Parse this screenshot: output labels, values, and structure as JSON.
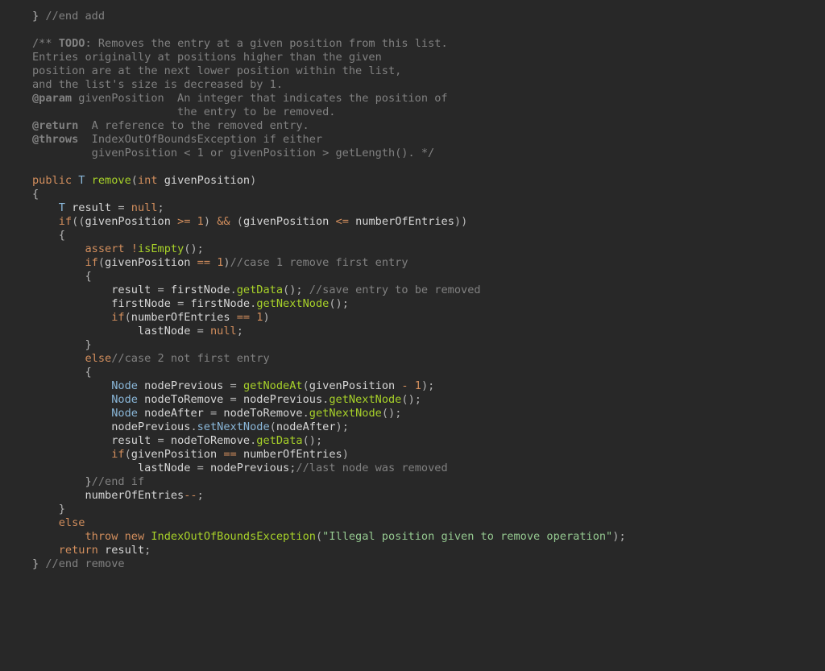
{
  "code": {
    "line01_a": "}",
    "line01_b": " //end add",
    "line03_a": "/** ",
    "line03_b": "TODO",
    "line03_c": ": Removes the entry at a given position from this list.",
    "line04": "Entries originally at positions higher than the given",
    "line05": "position are at the next lower position within the list,",
    "line06": "and the list's size is decreased by 1.",
    "line07_a": "@param",
    "line07_b": " givenPosition  An integer that indicates the position of",
    "line08": "                      the entry to be removed.",
    "line09_a": "@return",
    "line09_b": "  A reference to the removed entry.",
    "line10_a": "@throws",
    "line10_b": "  IndexOutOfBoundsException if either",
    "line11": "         givenPosition < 1 or givenPosition > getLength(). */",
    "kw_public": "public",
    "type_T": "T",
    "m_remove": "remove",
    "type_int": "int",
    "id_givenPosition": "givenPosition",
    "brace_open": "{",
    "brace_close": "}",
    "paren_open": "(",
    "paren_close": ")",
    "semi": ";",
    "space": " ",
    "indent1": "    ",
    "indent2": "        ",
    "indent3": "            ",
    "indent4": "                ",
    "id_result": "result",
    "assign": " = ",
    "kw_null": "null",
    "kw_if": "if",
    "op_ge": " >= ",
    "num_1": "1",
    "op_and": " && ",
    "op_le": " <= ",
    "id_numberOfEntries": "numberOfEntries",
    "kw_assert": "assert",
    "op_not": "!",
    "m_isEmpty": "isEmpty",
    "op_eq": " == ",
    "cmt_case1": "//case 1 remove first entry",
    "id_firstNode": "firstNode",
    "dot": ".",
    "m_getData": "getData",
    "cmt_save": " //save entry to be removed",
    "m_getNextNode": "getNextNode",
    "id_lastNode": "lastNode",
    "kw_else": "else",
    "cmt_case2": "//case 2 not first entry",
    "type_Node": "Node",
    "id_nodePrevious": "nodePrevious",
    "m_getNodeAt": "getNodeAt",
    "op_minus": " - ",
    "id_nodeToRemove": "nodeToRemove",
    "id_nodeAfter": "nodeAfter",
    "m_setNextNode": "setNextNode",
    "cmt_lastnode": "//last node was removed",
    "cmt_endif": "//end if",
    "op_dec": "--",
    "kw_throw": "throw",
    "kw_new": "new",
    "type_Exception": "IndexOutOfBoundsException",
    "str_msg": "\"Illegal position given to remove operation\"",
    "kw_return": "return",
    "cmt_endremove": " //end remove"
  }
}
